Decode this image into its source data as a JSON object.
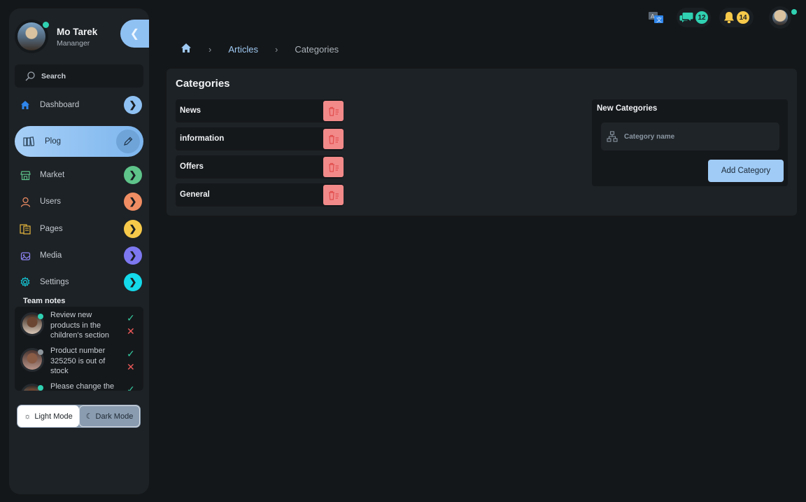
{
  "user": {
    "name": "Mo Tarek",
    "role": "Mananger"
  },
  "sidebar": {
    "collapse_icon": "chevron-left-icon",
    "search_label": "Search",
    "items": [
      {
        "label": "Dashboard",
        "icon": "home-icon",
        "accent": "#8fc1f3"
      },
      {
        "label": "Plog",
        "icon": "book-icon",
        "accent": "#6fa4d9",
        "active": true
      },
      {
        "label": "Market",
        "icon": "store-icon",
        "accent": "#5ec48a"
      },
      {
        "label": "Users",
        "icon": "user-icon",
        "accent": "#f08d63"
      },
      {
        "label": "Pages",
        "icon": "pages-icon",
        "accent": "#f6c94a"
      },
      {
        "label": "Media",
        "icon": "media-icon",
        "accent": "#7d78f0"
      },
      {
        "label": "Settings",
        "icon": "gear-icon",
        "accent": "#14d9ea"
      }
    ],
    "team_notes_title": "Team notes",
    "notes": [
      {
        "text": "Review new products in the children's section"
      },
      {
        "text": "Product number 325250 is out of stock"
      },
      {
        "text": "Please change the"
      }
    ],
    "mode": {
      "light": "Light Mode",
      "dark": "Dark Mode"
    }
  },
  "topbar": {
    "messages_count": "12",
    "notifications_count": "14"
  },
  "breadcrumb": {
    "home_icon": "home-icon",
    "articles": "Articles",
    "current": "Categories"
  },
  "categories_panel": {
    "title": "Categories",
    "items": [
      {
        "name": "News"
      },
      {
        "name": "information"
      },
      {
        "name": "Offers"
      },
      {
        "name": "General"
      }
    ]
  },
  "new_category": {
    "title": "New Categories",
    "placeholder": "Category name",
    "value": "",
    "button": "Add Category"
  },
  "colors": {
    "accent": "#9fcbf6",
    "delete": "#f28a8a",
    "online": "#2fd1b2",
    "bg": "#141719",
    "panel": "#1d2226"
  }
}
